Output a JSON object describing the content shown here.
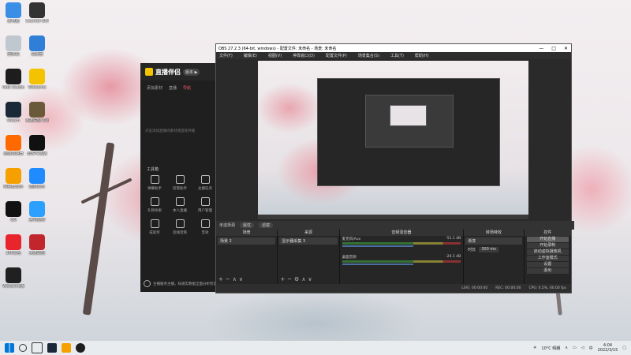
{
  "desktop_icons": [
    {
      "label": "此电脑",
      "color": "#3a8ee6"
    },
    {
      "label": "Counter-Strike",
      "color": "#333333"
    },
    {
      "label": "回收站",
      "color": "#bfc7cf"
    },
    {
      "label": "加速器",
      "color": "#2f7fd8"
    },
    {
      "label": "OBS Studio",
      "color": "#1d1d1d"
    },
    {
      "label": "WeGame",
      "color": "#f4c300"
    },
    {
      "label": "Steam",
      "color": "#1b2838"
    },
    {
      "label": "英雄联盟 WeGame版",
      "color": "#6a5a3a"
    },
    {
      "label": "迅游加速器",
      "color": "#ff6a00"
    },
    {
      "label": "剪映专业版",
      "color": "#111111"
    },
    {
      "label": "网易云音乐",
      "color": "#f6a000"
    },
    {
      "label": "酷狗音乐",
      "color": "#1f8bff"
    },
    {
      "label": "QQ",
      "color": "#111111"
    },
    {
      "label": "腾讯视频",
      "color": "#2ba0ff"
    },
    {
      "label": "360安全",
      "color": "#e8252c"
    },
    {
      "label": "英雄联盟",
      "color": "#c2262d"
    },
    {
      "label": "WeGame版",
      "color": "#202020"
    }
  ],
  "zhibo": {
    "title": "直播伴侣",
    "pill": "版本 ▶",
    "tabs": [
      "添加素材",
      "直播",
      "导航"
    ],
    "empty_text": "点击添加直播间素材或直接开播",
    "section": "工具箱",
    "tools": [
      "弹幕助手",
      "房管助手",
      "主播任务",
      "礼物效果",
      "本人直播",
      "用户管理",
      "成就奖",
      "连线话筒",
      "音效"
    ],
    "footer": "主播服务主播，知道实数据全面分析检测"
  },
  "obs": {
    "title": "OBS 27.2.3 (64-bit, windows) - 配置文件: 未命名 - 场景: 未命名",
    "controls": [
      "—",
      "□",
      "✕"
    ],
    "menu": [
      "文件(F)",
      "编辑(E)",
      "视图(V)",
      "停靠窗口(D)",
      "配置文件(P)",
      "场景集合(S)",
      "工具(T)",
      "帮助(H)"
    ],
    "no_source": "未选择源",
    "scene_btns": [
      "属性",
      "滤镜"
    ],
    "docks": {
      "scenes": {
        "title": "场景",
        "items": [
          "场景 2"
        ]
      },
      "sources": {
        "title": "来源",
        "items": [
          "显示器采集 3"
        ]
      },
      "mixer": {
        "title": "音频混音器",
        "channels": [
          {
            "name": "麦克风/Aux",
            "db": "-51.1 dB"
          },
          {
            "name": "桌面音频",
            "db": "-24.1 dB"
          }
        ]
      },
      "transitions": {
        "title": "转场特效",
        "type": "渐变",
        "duration_label": "时长",
        "duration": "300 ms"
      },
      "controls": {
        "title": "控件",
        "buttons": [
          "开始直播",
          "开始录制",
          "启动虚拟摄像机",
          "工作室模式",
          "设置",
          "退出"
        ]
      }
    },
    "status": {
      "live": "LIVE: 00:00:00",
      "rec": "REC: 00:00:00",
      "cpu": "CPU: 0.5%, 60.00 fps"
    }
  },
  "taskbar": {
    "weather": "10°C 晴朗",
    "time": "4:04",
    "date": "2022/3/15",
    "lang": "中"
  }
}
